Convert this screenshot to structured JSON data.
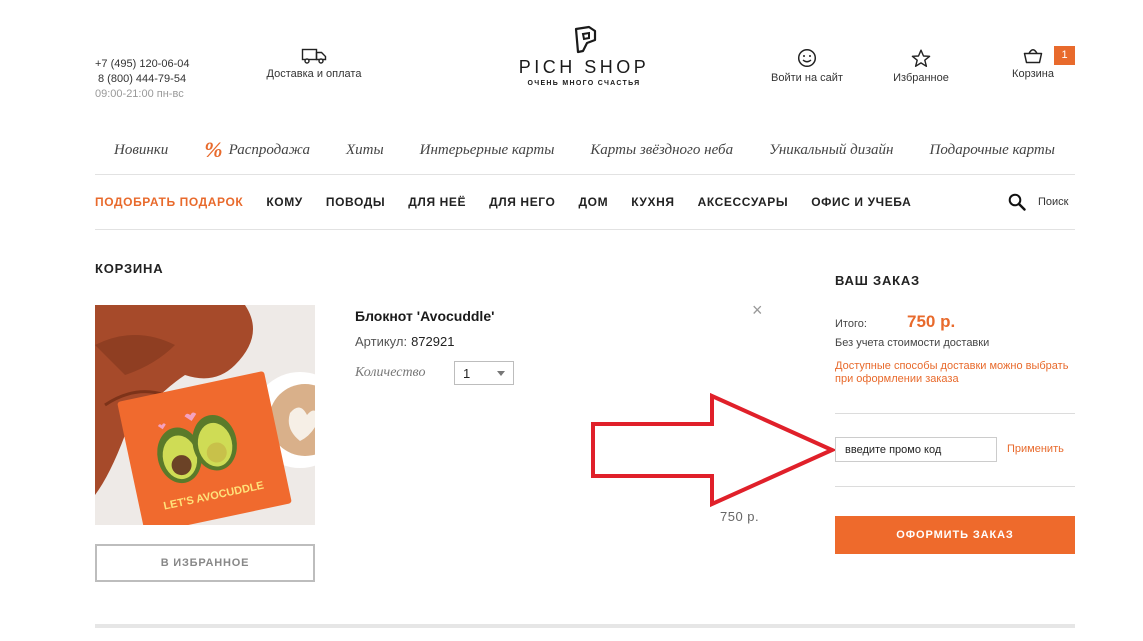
{
  "header": {
    "phone1": "+7 (495) 120-06-04",
    "phone2": "8 (800) 444-79-54",
    "hours": "09:00-21:00 пн-вс",
    "delivery_label": "Доставка и оплата",
    "logo_name": "PICH SHOP",
    "logo_tagline": "ОЧЕНЬ МНОГО СЧАСТЬЯ",
    "login_label": "Войти на сайт",
    "favorites_label": "Избранное",
    "cart_label": "Корзина",
    "cart_count": "1"
  },
  "menu_primary": {
    "items": [
      "Новинки",
      "Распродажа",
      "Хиты",
      "Интерьерные карты",
      "Карты звёздного неба",
      "Уникальный дизайн",
      "Подарочные карты"
    ],
    "sale_icon": "%"
  },
  "menu_secondary": {
    "items": [
      "ПОДОБРАТЬ ПОДАРОК",
      "КОМУ",
      "ПОВОДЫ",
      "ДЛЯ НЕЁ",
      "ДЛЯ НЕГО",
      "ДОМ",
      "КУХНЯ",
      "АКСЕССУАРЫ",
      "ОФИС И УЧЕБА"
    ],
    "search_label": "Поиск"
  },
  "cart": {
    "title": "КОРЗИНА",
    "item": {
      "name": "Блокнот 'Avocuddle'",
      "sku_label": "Артикул:",
      "sku": "872921",
      "qty_label": "Количество",
      "qty": "1",
      "price": "750 р.",
      "remove_icon": "×",
      "image_text": "LET'S AVOCUDDLE"
    },
    "favorite_button": "В ИЗБРАННОЕ"
  },
  "order": {
    "title": "ВАШ ЗАКАЗ",
    "total_label": "Итого:",
    "total_value": "750 р.",
    "no_shipping": "Без учета стоимости доставки",
    "shipping_note": "Доступные способы доставки можно выбрать при оформлении заказа",
    "promo_placeholder": "введите промо код",
    "apply_label": "Применить",
    "checkout_label": "ОФОРМИТЬ ЗАКАЗ"
  },
  "colors": {
    "accent": "#e86a2c",
    "annotation_arrow": "#e0202a"
  }
}
